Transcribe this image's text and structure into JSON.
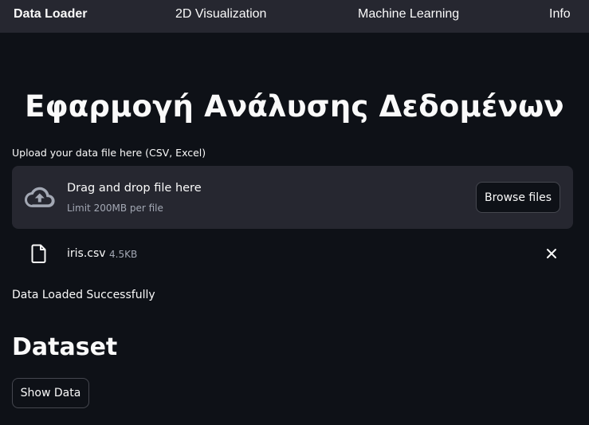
{
  "nav": {
    "items": [
      {
        "label": "Data Loader",
        "active": true
      },
      {
        "label": "2D Visualization",
        "active": false
      },
      {
        "label": "Machine Learning",
        "active": false
      },
      {
        "label": "Info",
        "active": false
      }
    ]
  },
  "page": {
    "title": "Εφαρμογή Ανάλυσης Δεδομένων"
  },
  "uploader": {
    "label": "Upload your data file here (CSV, Excel)",
    "drop_title": "Drag and drop file here",
    "drop_subtitle": "Limit 200MB per file",
    "browse_label": "Browse files",
    "icon": "cloud-upload-icon"
  },
  "uploaded_file": {
    "name": "iris.csv",
    "size": "4.5KB",
    "icon": "file-icon"
  },
  "status": {
    "message": "Data Loaded Successfully"
  },
  "dataset": {
    "heading": "Dataset",
    "show_button": "Show Data"
  },
  "colors": {
    "background": "#0e1117",
    "nav_background": "#262730",
    "dropzone_background": "#262730",
    "border": "#45474f",
    "muted_text": "#a3a8b4",
    "text": "#fafafa"
  }
}
